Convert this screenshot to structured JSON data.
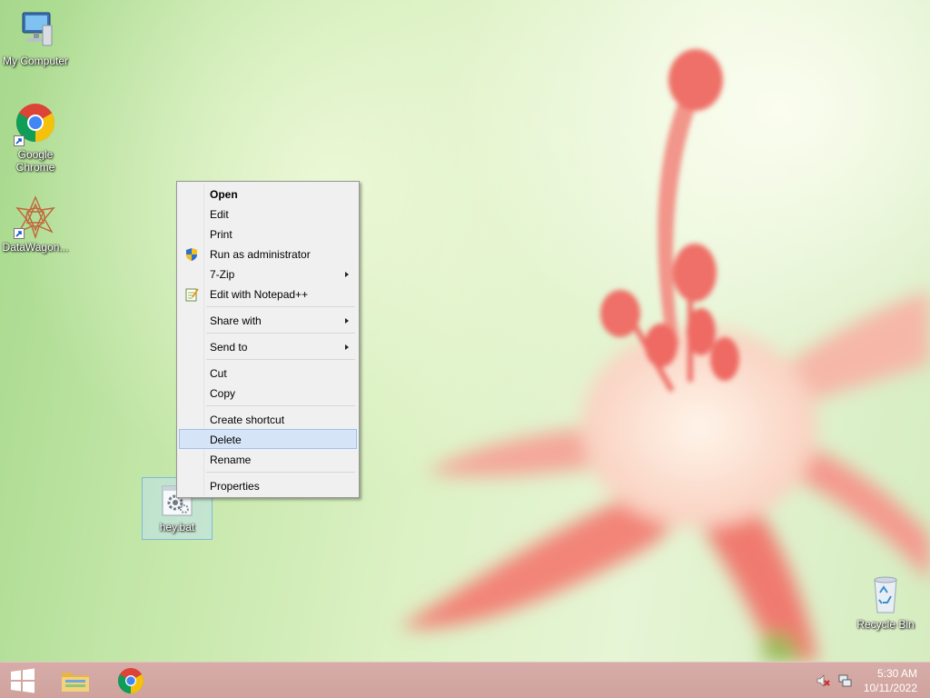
{
  "desktop": {
    "icons": [
      {
        "label": "My Computer",
        "icon": "computer-icon"
      },
      {
        "label": "Google Chrome",
        "icon": "chrome-icon"
      },
      {
        "label": "DataWagon...",
        "icon": "datawagon-icon"
      },
      {
        "label": "Recycle Bin",
        "icon": "recycle-bin-icon"
      }
    ],
    "selected_file": {
      "label": "hey.bat",
      "icon": "batch-file-gear-icon"
    }
  },
  "context_menu": {
    "items": [
      {
        "label": "Open",
        "bold": true
      },
      {
        "label": "Edit"
      },
      {
        "label": "Print"
      },
      {
        "label": "Run as administrator",
        "icon": "uac-shield-icon"
      },
      {
        "label": "7-Zip",
        "submenu": true
      },
      {
        "label": "Edit with Notepad++",
        "icon": "notepad-plus-plus-icon"
      },
      {
        "label": "Share with",
        "submenu": true
      },
      {
        "label": "Send to",
        "submenu": true
      },
      {
        "label": "Cut"
      },
      {
        "label": "Copy"
      },
      {
        "label": "Create shortcut"
      },
      {
        "label": "Delete",
        "highlighted": true
      },
      {
        "label": "Rename"
      },
      {
        "label": "Properties"
      }
    ]
  },
  "taskbar": {
    "buttons": [
      {
        "name": "start",
        "icon": "windows-logo-icon"
      },
      {
        "name": "file-explorer",
        "icon": "folder-icon"
      },
      {
        "name": "chrome",
        "icon": "chrome-icon"
      }
    ],
    "tray": {
      "icons": [
        "volume-muted-icon",
        "network-icon"
      ],
      "time": "5:30 AM",
      "date": "10/11/2022"
    }
  },
  "colors": {
    "taskbar": "#cfa29d",
    "menu_highlight": "#d5e4f7",
    "menu_background": "#f0f0f0"
  }
}
